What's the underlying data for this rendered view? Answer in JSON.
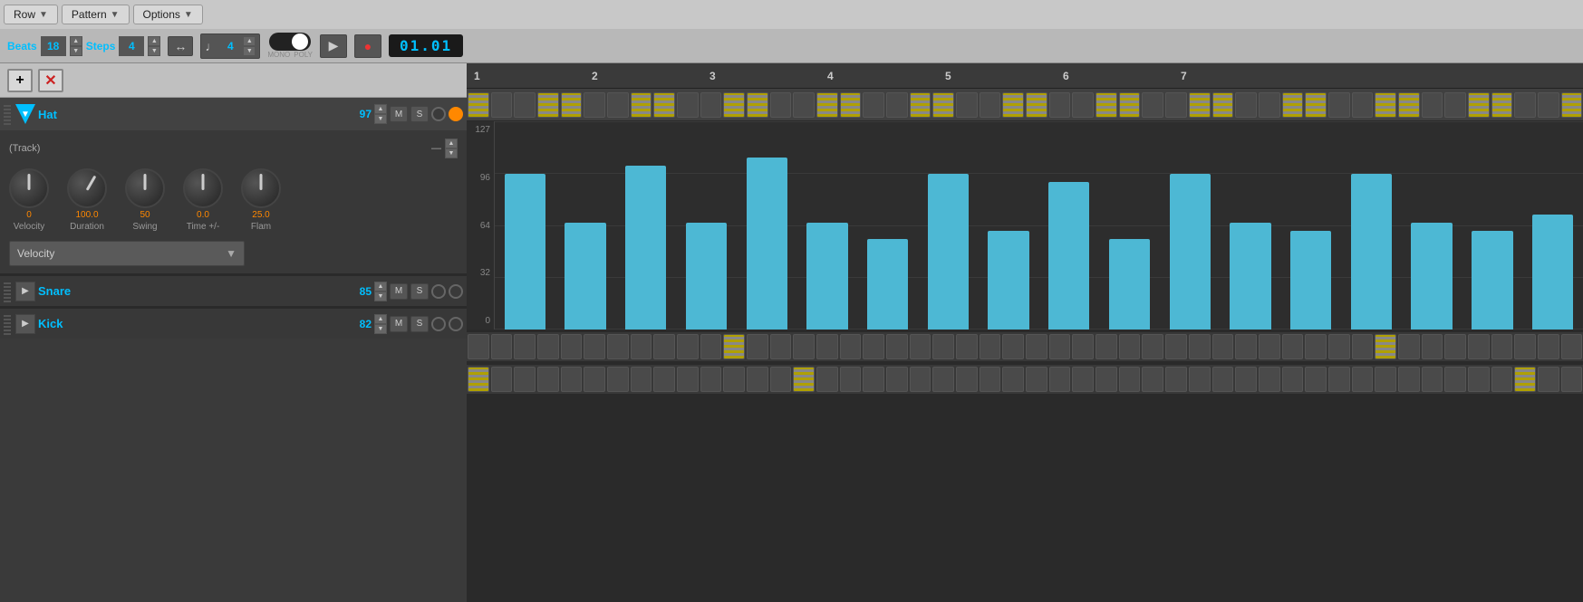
{
  "menu": {
    "row_label": "Row",
    "pattern_label": "Pattern",
    "options_label": "Options"
  },
  "transport": {
    "beats_label": "Beats",
    "beats_value": "18",
    "steps_label": "Steps",
    "steps_value": "4",
    "time_sig_value": "4",
    "mode_mono": "MONO",
    "mode_poly": "POLY",
    "time_display": "01.01"
  },
  "track_list": {
    "add_label": "+",
    "del_label": "✕"
  },
  "hat_track": {
    "name": "Hat",
    "volume": "97",
    "m_label": "M",
    "s_label": "S"
  },
  "knobs": {
    "track_label": "(Track)",
    "velocity_value": "0",
    "velocity_label": "Velocity",
    "duration_value": "100.0",
    "duration_label": "Duration",
    "swing_value": "50",
    "swing_label": "Swing",
    "time_value": "0.0",
    "time_label": "Time +/-",
    "flam_value": "25.0",
    "flam_label": "Flam",
    "dropdown_label": "Velocity",
    "y_axis": [
      "127",
      "96",
      "64",
      "32",
      "0"
    ]
  },
  "snare_track": {
    "name": "Snare",
    "volume": "85",
    "m_label": "M",
    "s_label": "S"
  },
  "kick_track": {
    "name": "Kick",
    "volume": "82",
    "m_label": "M",
    "s_label": "S"
  },
  "beat_numbers": [
    "1",
    "2",
    "3",
    "4",
    "5",
    "6",
    "7"
  ],
  "velocity_bars": [
    95,
    65,
    100,
    65,
    105,
    65,
    55,
    95,
    60,
    90,
    55,
    95,
    65,
    60,
    95,
    65,
    60,
    70
  ],
  "hat_buttons": [
    "striped",
    "inactive",
    "inactive",
    "striped",
    "striped",
    "inactive",
    "inactive",
    "striped",
    "striped",
    "inactive",
    "inactive",
    "striped",
    "striped",
    "inactive",
    "inactive",
    "striped",
    "striped",
    "inactive",
    "inactive",
    "striped",
    "striped",
    "inactive",
    "inactive",
    "striped",
    "striped",
    "inactive",
    "inactive",
    "striped",
    "striped",
    "inactive",
    "inactive",
    "striped",
    "striped",
    "inactive",
    "inactive",
    "striped",
    "striped",
    "inactive",
    "inactive",
    "striped",
    "striped",
    "inactive",
    "inactive",
    "striped",
    "striped",
    "inactive",
    "inactive",
    "striped"
  ],
  "snare_buttons": [
    "inactive",
    "inactive",
    "inactive",
    "inactive",
    "inactive",
    "inactive",
    "inactive",
    "inactive",
    "inactive",
    "inactive",
    "inactive",
    "striped",
    "inactive",
    "inactive",
    "inactive",
    "inactive",
    "inactive",
    "inactive",
    "inactive",
    "inactive",
    "inactive",
    "inactive",
    "inactive",
    "inactive",
    "inactive",
    "inactive",
    "inactive",
    "inactive",
    "inactive",
    "inactive",
    "inactive",
    "inactive",
    "inactive",
    "inactive",
    "inactive",
    "inactive",
    "inactive",
    "inactive",
    "inactive",
    "striped",
    "inactive",
    "inactive",
    "inactive",
    "inactive",
    "inactive",
    "inactive",
    "inactive",
    "inactive"
  ],
  "kick_buttons": [
    "striped",
    "inactive",
    "inactive",
    "inactive",
    "inactive",
    "inactive",
    "inactive",
    "inactive",
    "inactive",
    "inactive",
    "inactive",
    "inactive",
    "inactive",
    "inactive",
    "striped",
    "inactive",
    "inactive",
    "inactive",
    "inactive",
    "inactive",
    "inactive",
    "inactive",
    "inactive",
    "inactive",
    "inactive",
    "inactive",
    "inactive",
    "inactive",
    "inactive",
    "inactive",
    "inactive",
    "inactive",
    "inactive",
    "inactive",
    "inactive",
    "inactive",
    "inactive",
    "inactive",
    "inactive",
    "inactive",
    "inactive",
    "inactive",
    "inactive",
    "inactive",
    "inactive",
    "striped",
    "inactive",
    "inactive"
  ]
}
